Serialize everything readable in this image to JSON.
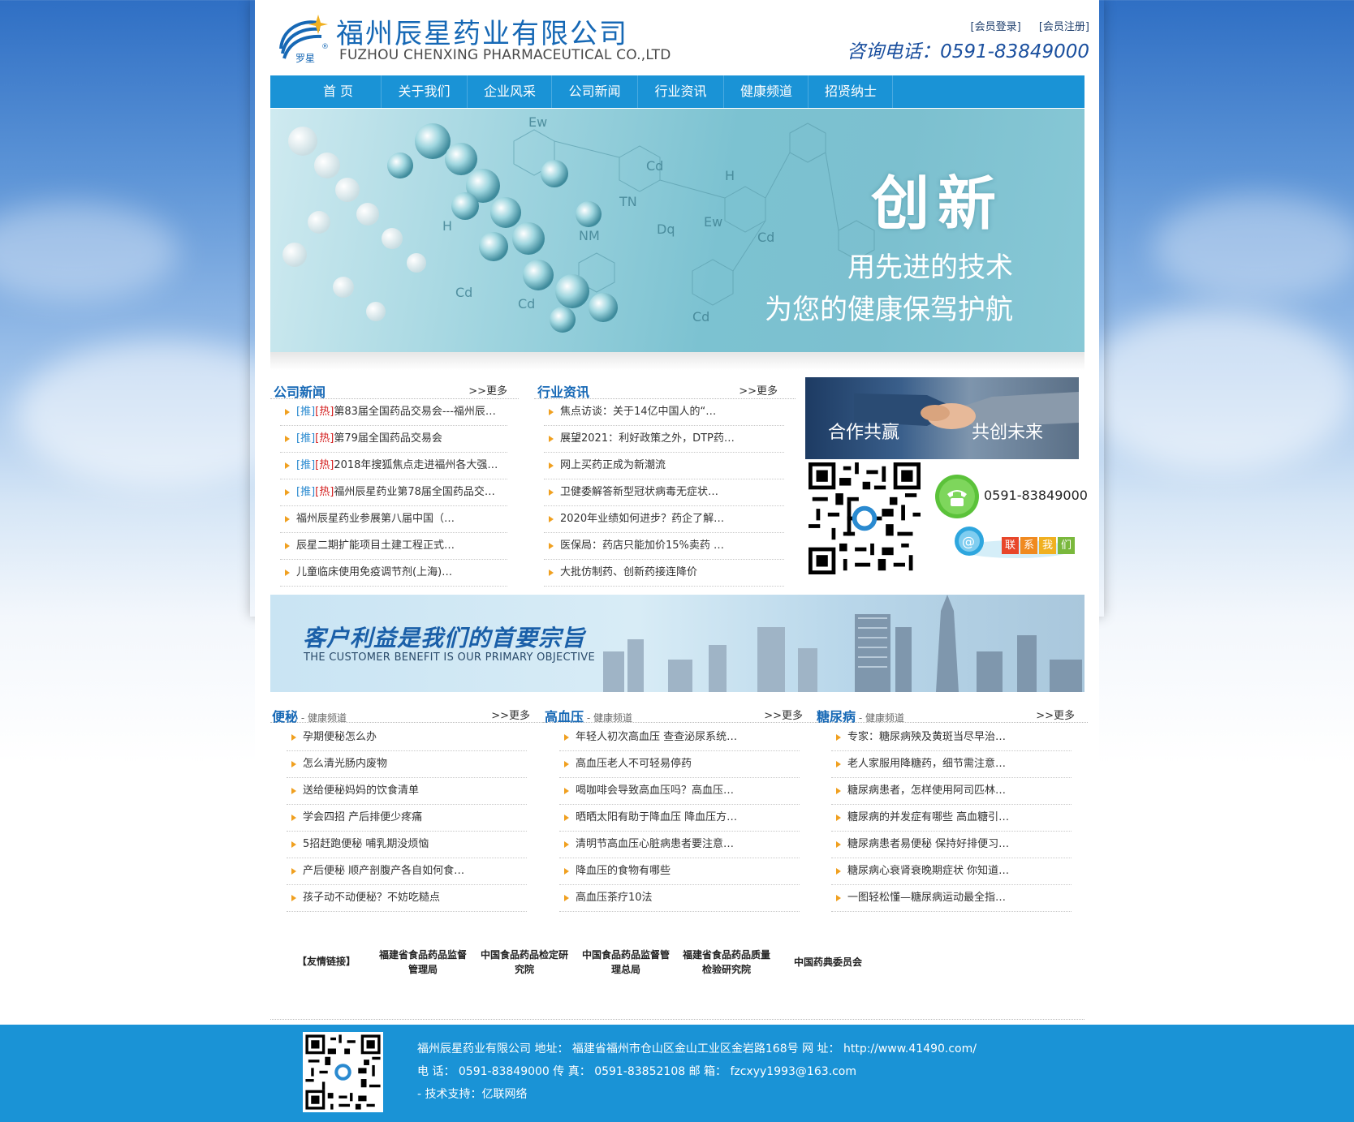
{
  "company": {
    "name_cn": "福州辰星药业有限公司",
    "name_en": "FUZHOU CHENXING PHARMACEUTICAL CO.,LTD",
    "logo_mark": "罗星",
    "hotline": "咨询电话：0591-83849000"
  },
  "member": {
    "login": "[会员登录]",
    "register": "[会员注册]"
  },
  "nav": [
    "首 页",
    "关于我们",
    "企业风采",
    "公司新闻",
    "行业资讯",
    "健康频道",
    "招贤纳士"
  ],
  "banner": {
    "title": "创新",
    "line1": "用先进的技术",
    "line2": "为您的健康保驾护航"
  },
  "company_news": {
    "title": "公司新闻",
    "more": ">>更多",
    "tag_rec": "[推]",
    "tag_hot": "[热]",
    "items": [
      {
        "rec": true,
        "text": "第83届全国药品交易会---福州辰…"
      },
      {
        "rec": true,
        "text": "第79届全国药品交易会"
      },
      {
        "rec": true,
        "text": "2018年搜狐焦点走进福州各大强…"
      },
      {
        "rec": true,
        "text": "福州辰星药业第78届全国药品交…"
      },
      {
        "rec": false,
        "text": "福州辰星药业参展第八届中国（…"
      },
      {
        "rec": false,
        "text": "辰星二期扩能项目土建工程正式…"
      },
      {
        "rec": false,
        "text": "儿童临床使用免疫调节剂(上海)…"
      }
    ]
  },
  "industry_news": {
    "title": "行业资讯",
    "more": ">>更多",
    "items": [
      "焦点访谈：关于14亿中国人的“…",
      "展望2021：利好政策之外，DTP药…",
      "网上买药正成为新潮流",
      "卫健委解答新型冠状病毒无症状…",
      "2020年业绩如何进步？药企了解…",
      "医保局：药店只能加价15%卖药 …",
      "大批仿制药、创新药接连降价"
    ]
  },
  "side": {
    "coop_left": "合作共赢",
    "coop_right": "共创未来",
    "phone": "0591-83849000",
    "contact": [
      "联",
      "系",
      "我",
      "们"
    ],
    "icons": [
      "qr-code-icon",
      "telephone-icon",
      "email-icon"
    ]
  },
  "slogan": {
    "cn": "客户利益是我们的首要宗旨",
    "en": "THE CUSTOMER BENEFIT IS OUR PRIMARY OBJECTIVE"
  },
  "health": [
    {
      "title": "便秘",
      "sub": " - 健康频道",
      "more": ">>更多",
      "items": [
        "孕期便秘怎么办",
        "怎么清光肠内废物",
        "送给便秘妈妈的饮食清单",
        "学会四招 产后排便少疼痛",
        "5招赶跑便秘 哺乳期没烦恼",
        "产后便秘 顺产剖腹产各自如何食…",
        "孩子动不动便秘？不妨吃糙点"
      ]
    },
    {
      "title": "高血压",
      "sub": " - 健康频道",
      "more": ">>更多",
      "items": [
        "年轻人初次高血压 查查泌尿系统…",
        "高血压老人不可轻易停药",
        "喝咖啡会导致高血压吗？高血压…",
        "晒晒太阳有助于降血压 降血压方…",
        "清明节高血压心脏病患者要注意…",
        "降血压的食物有哪些",
        "高血压茶疗10法"
      ]
    },
    {
      "title": "糖尿病",
      "sub": " - 健康频道",
      "more": ">>更多",
      "items": [
        "专家：糖尿病殃及黄斑当尽早治…",
        "老人家服用降糖药，细节需注意…",
        "糖尿病患者，怎样使用阿司匹林…",
        "糖尿病的并发症有哪些 高血糖引…",
        "糖尿病患者易便秘 保持好排便习…",
        "糖尿病心衰肾衰晚期症状 你知道…",
        "一图轻松懂—糖尿病运动最全指…"
      ]
    }
  ],
  "links": {
    "label": "【友情链接】",
    "items": [
      "福建省食品药品监督管理局",
      "中国食品药品检定研究院",
      "中国食品药品监督管理总局",
      "福建省食品药品质量检验研究院",
      "中国药典委员会"
    ]
  },
  "footer": {
    "line1": "福州辰星药业有限公司  地址： 福建省福州市仓山区金山工业区金岩路168号  网 址： http://www.41490.com/",
    "line2": "电 话： 0591-83849000 传 真： 0591-83852108 邮 箱： fzcxyy1993@163.com",
    "line3": "-  技术支持：亿联网络"
  },
  "colors": {
    "brand_blue": "#1a93d6",
    "title_blue": "#1668b5",
    "arrow": "#f0a020",
    "hot": "#d42020"
  }
}
